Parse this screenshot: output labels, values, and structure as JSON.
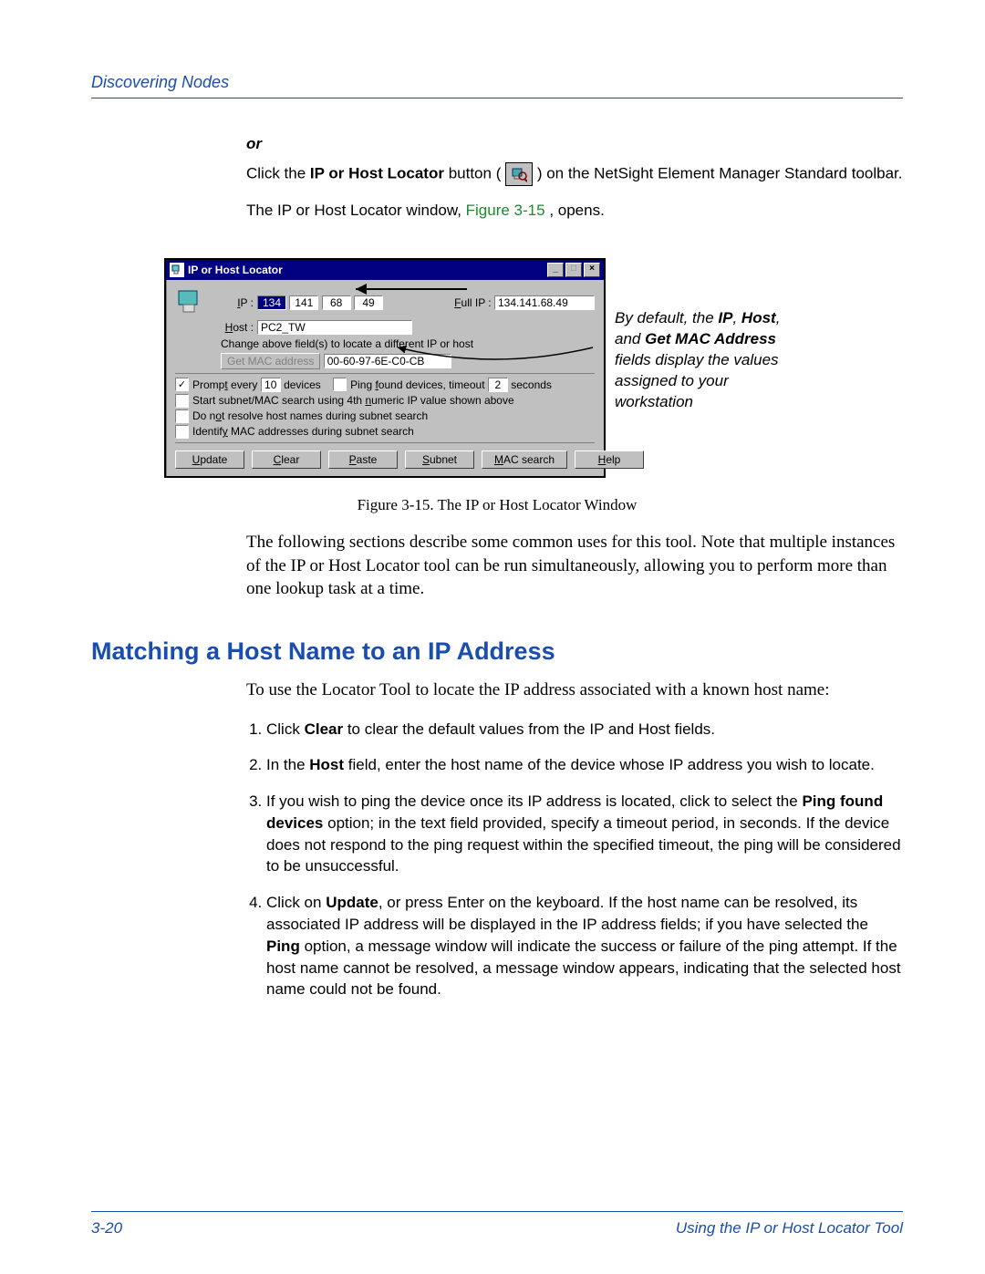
{
  "header": {
    "breadcrumb": "Discovering Nodes"
  },
  "intro": {
    "or": "or",
    "p1_a": "Click the ",
    "p1_btn": "IP or Host Locator",
    "p1_b": " button ( ",
    "p1_c": " ) on the NetSight Element Manager Standard toolbar.",
    "p2_a": "The IP or Host Locator window, ",
    "p2_xref": "Figure 3-15",
    "p2_b": ", opens."
  },
  "dialog": {
    "title": "IP or Host Locator",
    "ip_label": "IP :",
    "ip_octets": [
      "134",
      "141",
      "68",
      "49"
    ],
    "fullip_label": "Full IP :",
    "fullip_value": "134.141.68.49",
    "host_label": "Host :",
    "host_value": "PC2_TW",
    "change_note": "Change above field(s) to locate a different IP or host",
    "getmac_btn": "Get MAC address",
    "mac_value": "00-60-97-6E-C0-CB",
    "prompt_a": "Prompt every",
    "prompt_n": "10",
    "prompt_b": "devices",
    "ping_a": "Ping found devices, timeout",
    "ping_n": "2",
    "ping_b": "seconds",
    "opt_start": "Start subnet/MAC search using 4th numeric IP value shown above",
    "opt_noresolve": "Do not resolve host names during subnet search",
    "opt_identify": "Identify MAC addresses during subnet search",
    "buttons": {
      "update": "Update",
      "clear": "Clear",
      "paste": "Paste",
      "subnet": "Subnet",
      "mac": "MAC search",
      "help": "Help"
    },
    "sys": {
      "min": "_",
      "max": "□",
      "close": "×"
    }
  },
  "callout": {
    "a": "By default, the ",
    "b": "IP",
    "c": ", ",
    "d": "Host",
    "e": ", and ",
    "f": "Get MAC Address",
    "g": " fields display the values assigned to your workstation"
  },
  "caption": "Figure 3-15.  The IP or Host Locator Window",
  "para_following": "The following sections describe some common uses for this tool. Note that multiple instances of the IP or Host Locator tool can be run simultaneously, allowing you to perform more than one lookup task at a time.",
  "section_title": "Matching a Host Name to an IP Address",
  "section_lead": "To use the Locator Tool to locate the IP address associated with a known host name:",
  "steps": {
    "s1a": "Click ",
    "s1b": "Clear",
    "s1c": " to clear the default values from the IP and Host fields.",
    "s2a": "In the ",
    "s2b": "Host",
    "s2c": " field, enter the host name of the device whose IP address you wish to locate.",
    "s3a": "If you wish to ping the device once its IP address is located, click to select the ",
    "s3b": "Ping found devices",
    "s3c": " option; in the text field provided, specify a timeout period, in seconds. If the device does not respond to the ping request within the specified timeout, the ping will be considered to be unsuccessful.",
    "s4a": "Click on ",
    "s4b": "Update",
    "s4c": ", or press Enter on the keyboard. If the host name can be resolved, its associated IP address will be displayed in the IP address fields; if you have selected the ",
    "s4d": "Ping",
    "s4e": " option, a message window will indicate the success or failure of the ping attempt. If the host name cannot be resolved, a message window appears, indicating that the selected host name could not be found."
  },
  "footer": {
    "left": "3-20",
    "right": "Using the IP or Host Locator Tool"
  }
}
